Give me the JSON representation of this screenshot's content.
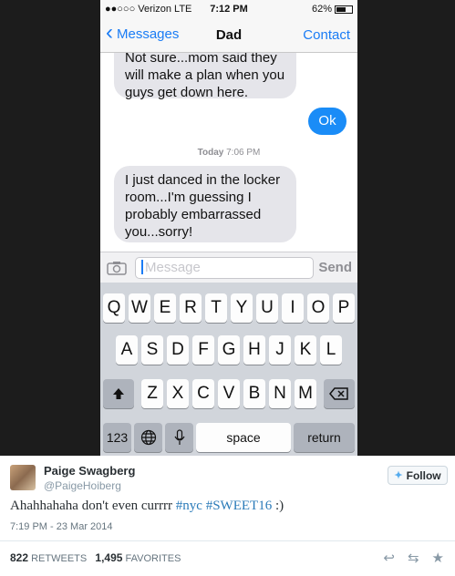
{
  "status_bar": {
    "carrier": "●●○○○ Verizon  LTE",
    "time": "7:12 PM",
    "battery": "62%",
    "battery_fraction": 0.62
  },
  "nav": {
    "back_label": "Messages",
    "title": "Dad",
    "contact_label": "Contact"
  },
  "messages": {
    "partial_incoming": "Not sure...mom said they will make a plan when you guys get down here.",
    "outgoing": "Ok",
    "timestamp_day": "Today",
    "timestamp_time": "7:06 PM",
    "incoming": "I just danced in the locker room...I'm guessing I probably embarrassed you...sorry!"
  },
  "input": {
    "placeholder": "Message",
    "send_label": "Send"
  },
  "keyboard": {
    "row1": [
      "Q",
      "W",
      "E",
      "R",
      "T",
      "Y",
      "U",
      "I",
      "O",
      "P"
    ],
    "row2": [
      "A",
      "S",
      "D",
      "F",
      "G",
      "H",
      "J",
      "K",
      "L"
    ],
    "row3": [
      "Z",
      "X",
      "C",
      "V",
      "B",
      "N",
      "M"
    ],
    "numbers_label": "123",
    "space_label": "space",
    "return_label": "return"
  },
  "tweet": {
    "user_name": "Paige Swagberg",
    "handle": "@PaigeHoiberg",
    "follow_label": "Follow",
    "text_plain": "Ahahhahaha don't even currrr ",
    "hashtag1": "#nyc",
    "hashtag2": "#SWEET16",
    "text_end": " :)",
    "timestamp": "7:19 PM - 23 Mar 2014",
    "retweets_count": "822",
    "retweets_label": "RETWEETS",
    "favorites_count": "1,495",
    "favorites_label": "FAVORITES"
  },
  "icons": [
    "back-chevron-icon",
    "camera-icon",
    "shift-icon",
    "delete-icon",
    "globe-icon",
    "microphone-icon",
    "twitter-bird-icon",
    "reply-icon",
    "retweet-icon",
    "favorite-icon"
  ]
}
